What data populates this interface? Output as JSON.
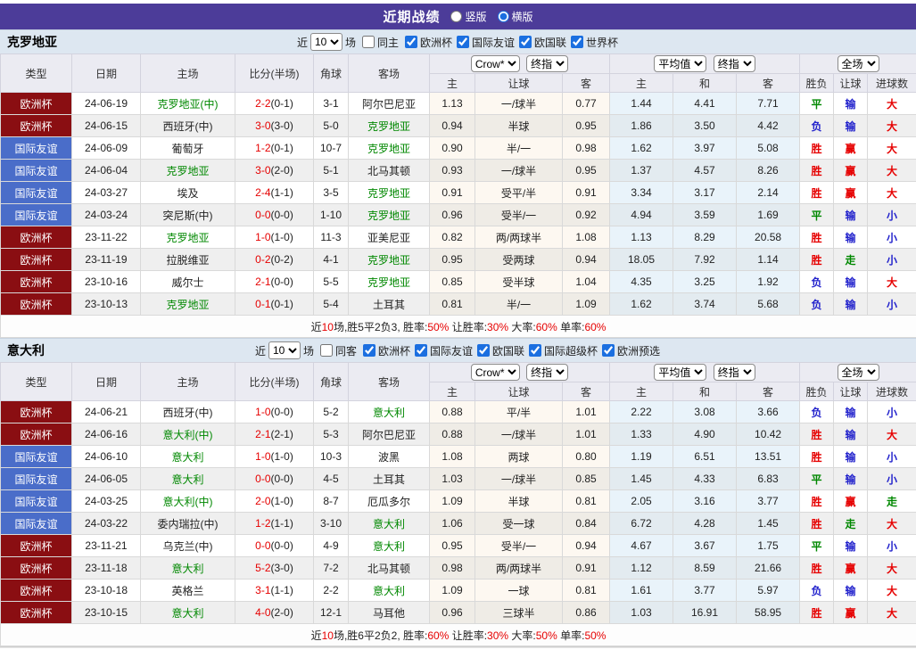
{
  "topbar": {
    "title": "近期战绩",
    "radio_vertical": "竖版",
    "radio_horizontal": "横版"
  },
  "table_header": {
    "cols": [
      "类型",
      "日期",
      "主场",
      "比分(半场)",
      "角球",
      "客场"
    ],
    "crow_select": "Crow*",
    "final_select": "终指",
    "avg_select": "平均值",
    "final_select2": "终指",
    "fullmatch_select": "全场",
    "crow_sub": [
      "主",
      "让球",
      "客"
    ],
    "avg_sub": [
      "主",
      "和",
      "客"
    ],
    "result_sub": [
      "胜负",
      "让球",
      "进球数"
    ]
  },
  "sections": [
    {
      "team": "克罗地亚",
      "filter": {
        "near_label": "近",
        "count": "10",
        "games_label": "场",
        "same_label": "同主",
        "same_checked": false,
        "leagues": [
          "欧洲杯",
          "国际友谊",
          "欧国联",
          "世界杯"
        ]
      },
      "rows": [
        [
          "欧洲杯",
          "24-06-19",
          "克罗地亚(中)",
          "2-2",
          "0-1",
          "3-1",
          "阿尔巴尼亚",
          "1.13",
          "一/球半",
          "0.77",
          "1.44",
          "4.41",
          "7.71",
          "平",
          "输",
          "大"
        ],
        [
          "欧洲杯",
          "24-06-15",
          "西班牙(中)",
          "3-0",
          "3-0",
          "5-0",
          "克罗地亚",
          "0.94",
          "半球",
          "0.95",
          "1.86",
          "3.50",
          "4.42",
          "负",
          "输",
          "大"
        ],
        [
          "国际友谊",
          "24-06-09",
          "葡萄牙",
          "1-2",
          "0-1",
          "10-7",
          "克罗地亚",
          "0.90",
          "半/一",
          "0.98",
          "1.62",
          "3.97",
          "5.08",
          "胜",
          "赢",
          "大"
        ],
        [
          "国际友谊",
          "24-06-04",
          "克罗地亚",
          "3-0",
          "2-0",
          "5-1",
          "北马其顿",
          "0.93",
          "一/球半",
          "0.95",
          "1.37",
          "4.57",
          "8.26",
          "胜",
          "赢",
          "大"
        ],
        [
          "国际友谊",
          "24-03-27",
          "埃及",
          "2-4",
          "1-1",
          "3-5",
          "克罗地亚",
          "0.91",
          "受平/半",
          "0.91",
          "3.34",
          "3.17",
          "2.14",
          "胜",
          "赢",
          "大"
        ],
        [
          "国际友谊",
          "24-03-24",
          "突尼斯(中)",
          "0-0",
          "0-0",
          "1-10",
          "克罗地亚",
          "0.96",
          "受半/一",
          "0.92",
          "4.94",
          "3.59",
          "1.69",
          "平",
          "输",
          "小"
        ],
        [
          "欧洲杯",
          "23-11-22",
          "克罗地亚",
          "1-0",
          "1-0",
          "11-3",
          "亚美尼亚",
          "0.82",
          "两/两球半",
          "1.08",
          "1.13",
          "8.29",
          "20.58",
          "胜",
          "输",
          "小"
        ],
        [
          "欧洲杯",
          "23-11-19",
          "拉脱维亚",
          "0-2",
          "0-2",
          "4-1",
          "克罗地亚",
          "0.95",
          "受两球",
          "0.94",
          "18.05",
          "7.92",
          "1.14",
          "胜",
          "走",
          "小"
        ],
        [
          "欧洲杯",
          "23-10-16",
          "威尔士",
          "2-1",
          "0-0",
          "5-5",
          "克罗地亚",
          "0.85",
          "受半球",
          "1.04",
          "4.35",
          "3.25",
          "1.92",
          "负",
          "输",
          "大"
        ],
        [
          "欧洲杯",
          "23-10-13",
          "克罗地亚",
          "0-1",
          "0-1",
          "5-4",
          "土耳其",
          "0.81",
          "半/一",
          "1.09",
          "1.62",
          "3.74",
          "5.68",
          "负",
          "输",
          "小"
        ]
      ],
      "summary": [
        {
          "t": "近"
        },
        {
          "t": "10",
          "red": true
        },
        {
          "t": "场,胜5平2负3, 胜率:"
        },
        {
          "t": "50%",
          "red": true
        },
        {
          "t": " 让胜率:"
        },
        {
          "t": "30%",
          "red": true
        },
        {
          "t": " 大率:"
        },
        {
          "t": "60%",
          "red": true
        },
        {
          "t": " 单率:"
        },
        {
          "t": "60%",
          "red": true
        }
      ]
    },
    {
      "team": "意大利",
      "filter": {
        "near_label": "近",
        "count": "10",
        "games_label": "场",
        "same_label": "同客",
        "same_checked": false,
        "leagues": [
          "欧洲杯",
          "国际友谊",
          "欧国联",
          "国际超级杯",
          "欧洲预选"
        ]
      },
      "rows": [
        [
          "欧洲杯",
          "24-06-21",
          "西班牙(中)",
          "1-0",
          "0-0",
          "5-2",
          "意大利",
          "0.88",
          "平/半",
          "1.01",
          "2.22",
          "3.08",
          "3.66",
          "负",
          "输",
          "小"
        ],
        [
          "欧洲杯",
          "24-06-16",
          "意大利(中)",
          "2-1",
          "2-1",
          "5-3",
          "阿尔巴尼亚",
          "0.88",
          "一/球半",
          "1.01",
          "1.33",
          "4.90",
          "10.42",
          "胜",
          "输",
          "大"
        ],
        [
          "国际友谊",
          "24-06-10",
          "意大利",
          "1-0",
          "1-0",
          "10-3",
          "波黑",
          "1.08",
          "两球",
          "0.80",
          "1.19",
          "6.51",
          "13.51",
          "胜",
          "输",
          "小"
        ],
        [
          "国际友谊",
          "24-06-05",
          "意大利",
          "0-0",
          "0-0",
          "4-5",
          "土耳其",
          "1.03",
          "一/球半",
          "0.85",
          "1.45",
          "4.33",
          "6.83",
          "平",
          "输",
          "小"
        ],
        [
          "国际友谊",
          "24-03-25",
          "意大利(中)",
          "2-0",
          "1-0",
          "8-7",
          "厄瓜多尔",
          "1.09",
          "半球",
          "0.81",
          "2.05",
          "3.16",
          "3.77",
          "胜",
          "赢",
          "走"
        ],
        [
          "国际友谊",
          "24-03-22",
          "委内瑞拉(中)",
          "1-2",
          "1-1",
          "3-10",
          "意大利",
          "1.06",
          "受一球",
          "0.84",
          "6.72",
          "4.28",
          "1.45",
          "胜",
          "走",
          "大"
        ],
        [
          "欧洲杯",
          "23-11-21",
          "乌克兰(中)",
          "0-0",
          "0-0",
          "4-9",
          "意大利",
          "0.95",
          "受半/一",
          "0.94",
          "4.67",
          "3.67",
          "1.75",
          "平",
          "输",
          "小"
        ],
        [
          "欧洲杯",
          "23-11-18",
          "意大利",
          "5-2",
          "3-0",
          "7-2",
          "北马其顿",
          "0.98",
          "两/两球半",
          "0.91",
          "1.12",
          "8.59",
          "21.66",
          "胜",
          "赢",
          "大"
        ],
        [
          "欧洲杯",
          "23-10-18",
          "英格兰",
          "3-1",
          "1-1",
          "2-2",
          "意大利",
          "1.09",
          "一球",
          "0.81",
          "1.61",
          "3.77",
          "5.97",
          "负",
          "输",
          "大"
        ],
        [
          "欧洲杯",
          "23-10-15",
          "意大利",
          "4-0",
          "2-0",
          "12-1",
          "马耳他",
          "0.96",
          "三球半",
          "0.86",
          "1.03",
          "16.91",
          "58.95",
          "胜",
          "赢",
          "大"
        ]
      ],
      "summary": [
        {
          "t": "近"
        },
        {
          "t": "10",
          "red": true
        },
        {
          "t": "场,胜6平2负2, 胜率:"
        },
        {
          "t": "60%",
          "red": true
        },
        {
          "t": " 让胜率:"
        },
        {
          "t": "30%",
          "red": true
        },
        {
          "t": " 大率:"
        },
        {
          "t": "50%",
          "red": true
        },
        {
          "t": " 单率:"
        },
        {
          "t": "50%",
          "red": true
        }
      ]
    }
  ],
  "colors": {
    "header_bar": "#4c3c99",
    "type_bg": {
      "欧洲杯": "#8a0e12",
      "国际友谊": "#4a6dc9"
    },
    "team_green": "#008800",
    "score_red": "#e60000",
    "result_red": "#e60000",
    "result_blue": "#2222cc",
    "result_green": "#008800"
  }
}
